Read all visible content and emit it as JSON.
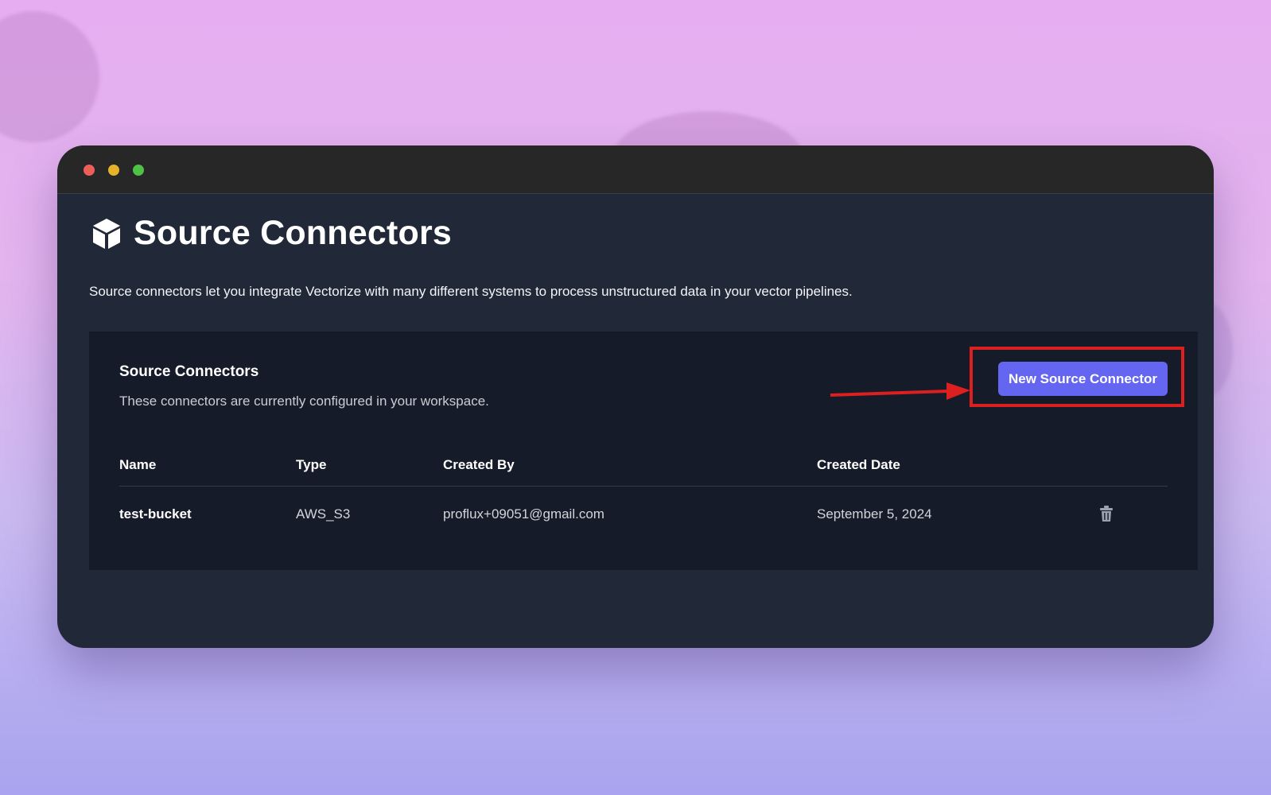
{
  "page": {
    "icon": "cube-icon",
    "title": "Source Connectors",
    "description": "Source connectors let you integrate Vectorize with many different systems to process unstructured data in your vector pipelines."
  },
  "panel": {
    "title": "Source Connectors",
    "subtitle": "These connectors are currently configured in your workspace.",
    "new_button_label": "New Source Connector"
  },
  "table": {
    "columns": [
      "Name",
      "Type",
      "Created By",
      "Created Date"
    ],
    "rows": [
      {
        "name": "test-bucket",
        "type": "AWS_S3",
        "created_by": "proflux+09051@gmail.com",
        "created_date": "September 5, 2024",
        "action_icon": "trash-icon"
      }
    ]
  },
  "colors": {
    "accent_button": "#6466f1",
    "annotation_red": "#dc1f1f",
    "window_bg": "#212938",
    "panel_bg": "#151b28"
  }
}
